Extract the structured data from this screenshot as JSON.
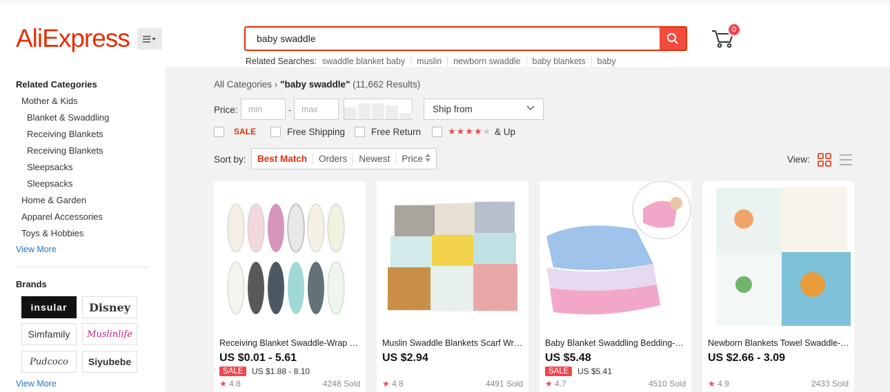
{
  "header": {
    "logo": "AliExpress",
    "search_value": "baby swaddle",
    "related_label": "Related Searches:",
    "related": [
      "swaddle blanket baby",
      "muslin",
      "newborn swaddle",
      "baby blankets",
      "baby"
    ],
    "cart_count": "0"
  },
  "sidebar": {
    "related_categories_title": "Related Categories",
    "categories": [
      {
        "label": "Mother & Kids",
        "level": 1
      },
      {
        "label": "Blanket & Swaddling",
        "level": 2
      },
      {
        "label": "Receiving Blankets",
        "level": 2
      },
      {
        "label": "Receiving Blankets",
        "level": 2
      },
      {
        "label": "Sleepsacks",
        "level": 2
      },
      {
        "label": "Sleepsacks",
        "level": 2
      },
      {
        "label": "Home & Garden",
        "level": 1
      },
      {
        "label": "Apparel Accessories",
        "level": 1
      },
      {
        "label": "Toys & Hobbies",
        "level": 1
      }
    ],
    "view_more": "View More",
    "brands_title": "Brands",
    "brands": [
      "insular",
      "Disney",
      "Simfamily",
      "Muslinlife",
      "Pudcoco",
      "Siyubebe"
    ],
    "brands_view_more": "View More"
  },
  "breadcrumb": {
    "root": "All Categories",
    "query": "\"baby swaddle\"",
    "results": "(11,662 Results)"
  },
  "filters": {
    "price_label": "Price:",
    "min_placeholder": "min",
    "max_placeholder": "max",
    "price_dash": "-",
    "price_histogram": [
      0.6,
      0.8,
      0.8,
      0.7,
      0.3
    ],
    "ship_from": "Ship from",
    "sale": "SALE",
    "free_shipping": "Free Shipping",
    "free_return": "Free Return",
    "rating_stars": 4,
    "rating_suffix": "& Up"
  },
  "sort": {
    "label": "Sort by:",
    "options": [
      "Best Match",
      "Orders",
      "Newest",
      "Price"
    ],
    "view_label": "View:"
  },
  "colors": {
    "brand": "#e62e04",
    "accent": "#f0474d",
    "link": "#2673c4"
  },
  "products": [
    {
      "title": "Receiving Blanket Swaddle-Wrap Baby Sleep Sack",
      "price": "US $0.01 - 5.61",
      "sale": "SALE",
      "orig": "US $1.88 - 8.10",
      "rating": "4.8",
      "sold": "4248 Sold"
    },
    {
      "title": "Muslin Swaddle Blankets Scarf Wrap Cotton Baby",
      "price": "US $2.94",
      "sale": "",
      "orig": "",
      "rating": "4.8",
      "sold": "4491 Sold"
    },
    {
      "title": "Baby Blanket Swaddling Bedding-Set Minky Dot",
      "price": "US $5.48",
      "sale": "SALE",
      "orig": "US $5.41",
      "rating": "4.7",
      "sold": "4510 Sold"
    },
    {
      "title": "Newborn Blankets Towel Swaddle-Wrap Muslin Cotton",
      "price": "US $2.66 - 3.09",
      "sale": "",
      "orig": "",
      "rating": "4.9",
      "sold": "2433 Sold"
    }
  ]
}
